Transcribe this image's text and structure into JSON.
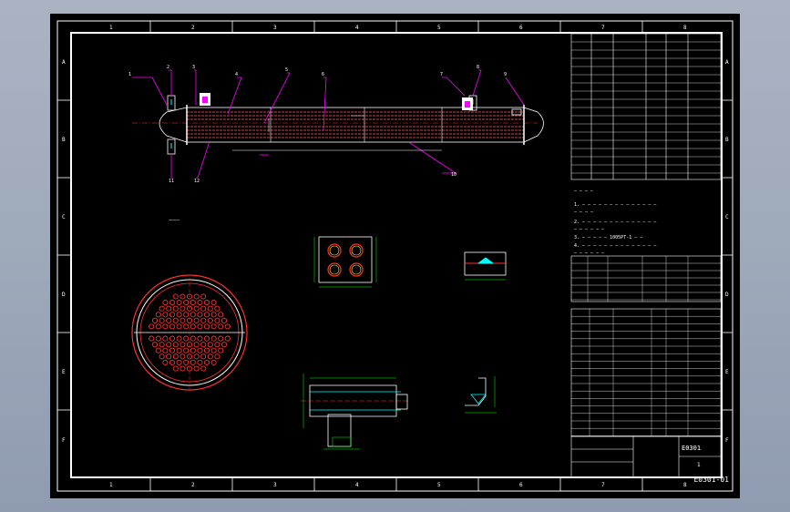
{
  "title_block": {
    "drawing_number": "E0301-01",
    "drawing_number_top": "E0301",
    "sheet_label": "1"
  },
  "tech_note_line": "1005PT-1",
  "colors": {
    "frame": "#ffffff",
    "leader": "#ff00ff",
    "tubes": "#ff3030",
    "dims": "#00ff00",
    "table_text": "#ffffff",
    "cyan": "#00ffff",
    "yellow": "#ffff00"
  },
  "border_letters": [
    "A",
    "B",
    "C",
    "D",
    "E",
    "F"
  ],
  "border_numbers": [
    "1",
    "2",
    "3",
    "4",
    "5",
    "6",
    "7",
    "8"
  ],
  "icons": [
    "flange-nozzle-icon",
    "flange-nozzle-icon",
    "flange-nozzle-icon"
  ]
}
